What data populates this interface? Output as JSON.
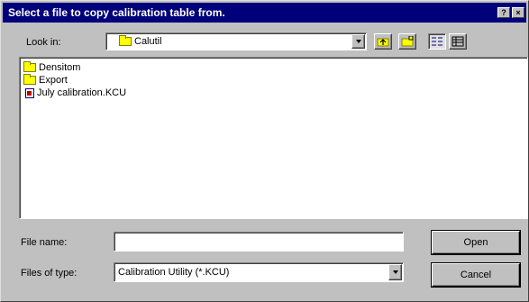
{
  "window": {
    "title": "Select a file to copy calibration table from.",
    "help_label": "?",
    "close_label": "×"
  },
  "lookin": {
    "label": "Look in:",
    "value": "Calutil"
  },
  "files": [
    {
      "type": "folder",
      "name": "Densitom"
    },
    {
      "type": "folder",
      "name": "Export"
    },
    {
      "type": "file",
      "name": "July calibration.KCU"
    }
  ],
  "filename": {
    "label": "File name:",
    "value": ""
  },
  "filetype": {
    "label": "Files of type:",
    "value": "Calibration Utility (*.KCU)"
  },
  "buttons": {
    "open": "Open",
    "cancel": "Cancel"
  }
}
